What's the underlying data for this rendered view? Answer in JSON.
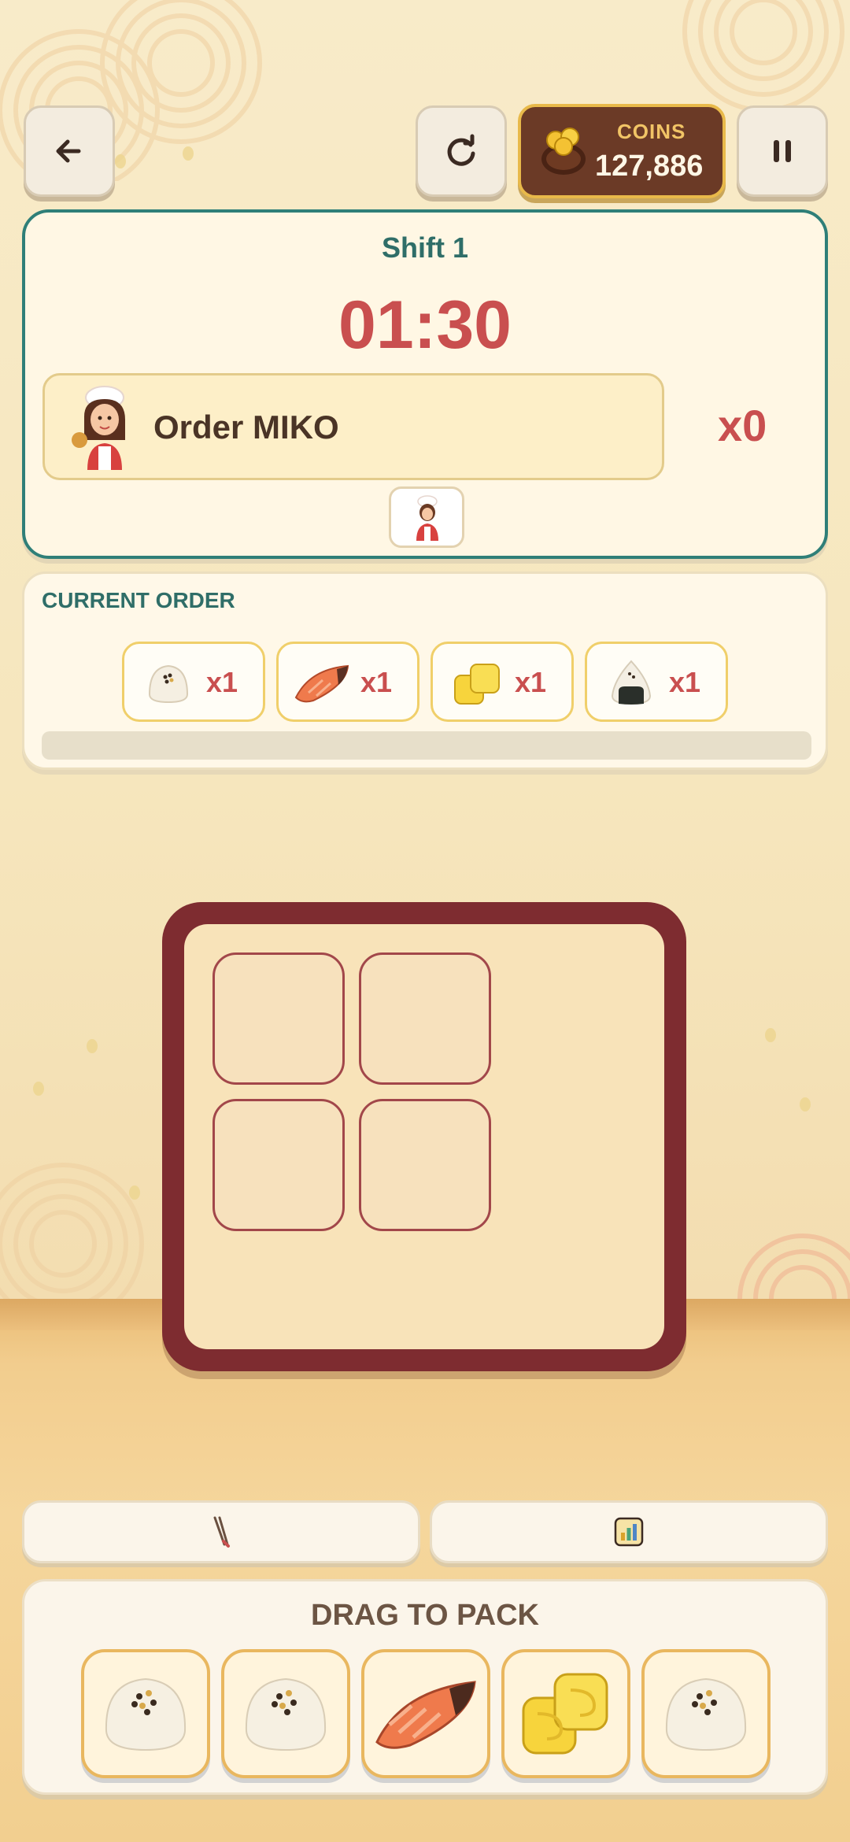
{
  "topbar": {
    "back_icon": "arrow-left-icon",
    "restart_icon": "restart-icon",
    "pause_icon": "pause-icon",
    "coins_label": "COINS",
    "coins_value": "127,886"
  },
  "header": {
    "shift": "Shift 1",
    "timer": "01:30",
    "order_name": "Order MIKO",
    "order_count": "x0"
  },
  "current_order": {
    "title": "CURRENT ORDER",
    "items": [
      {
        "icon": "rice-ball-icon",
        "qty": "x1"
      },
      {
        "icon": "salmon-icon",
        "qty": "x1"
      },
      {
        "icon": "tamagoyaki-icon",
        "qty": "x1"
      },
      {
        "icon": "onigiri-icon",
        "qty": "x1"
      }
    ],
    "progress": 0
  },
  "tools": {
    "left_icon": "chopsticks-icon",
    "right_icon": "stats-icon"
  },
  "tray": {
    "title": "DRAG TO PACK",
    "items": [
      "rice-ball-icon",
      "rice-ball-icon",
      "salmon-icon",
      "tamagoyaki-icon",
      "rice-ball-icon"
    ]
  },
  "colors": {
    "accent_teal": "#2f7f78",
    "accent_red": "#c94f4f",
    "bento_frame": "#7e2c30",
    "coins_bg": "#6b3a26"
  }
}
